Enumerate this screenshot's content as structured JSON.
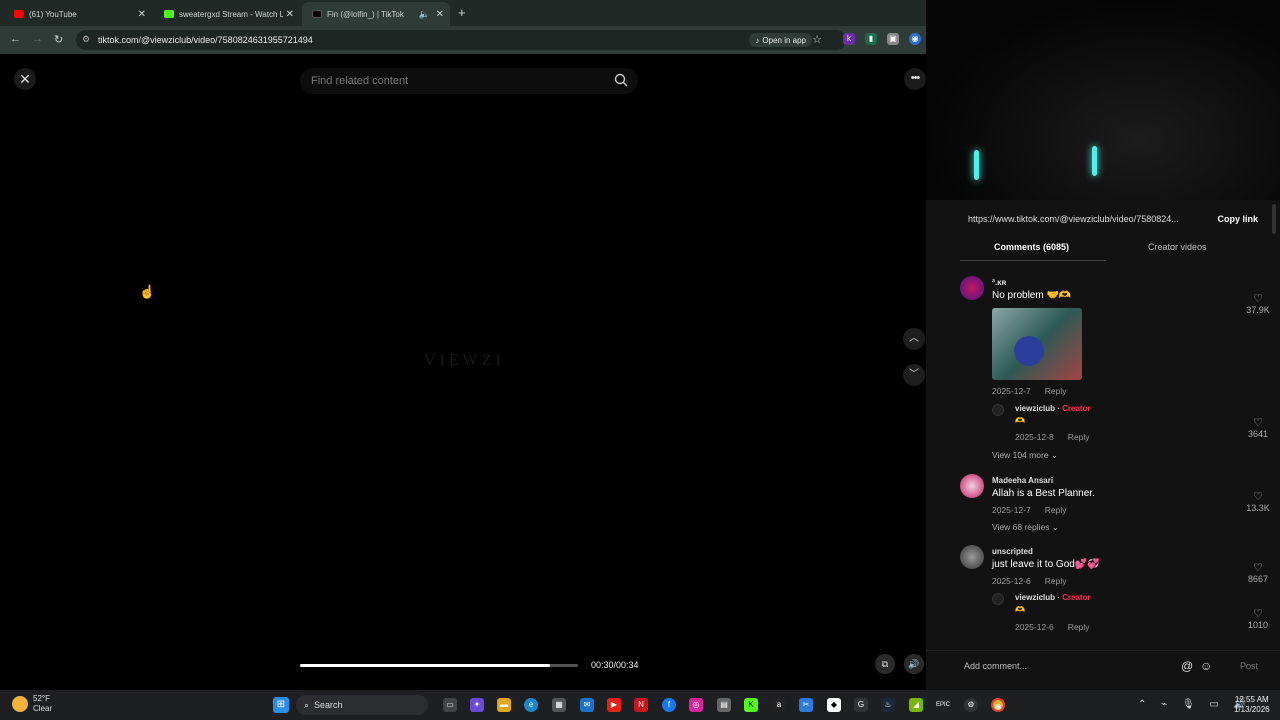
{
  "browser": {
    "tabs": [
      {
        "label": "(61) YouTube",
        "icon": "youtube-icon"
      },
      {
        "label": "sweatergxd Stream - Watch Live",
        "icon": "kick-icon"
      },
      {
        "label": "Fin (@lolfin_) | TikTok",
        "icon": "tiktok-icon",
        "active": true
      }
    ],
    "new_tab": "+",
    "url": "tiktok.com/@viewziclub/video/7580824631955721494",
    "open_in_app": "Open in app"
  },
  "video": {
    "search_placeholder": "Find related content",
    "watermark": "VIEWZI",
    "time": "00:30/00:34",
    "progress": 0.9
  },
  "panel": {
    "share_url": "https://www.tiktok.com/@viewziclub/video/7580824...",
    "copy_link": "Copy link",
    "tab_comments": "Comments (6085)",
    "tab_creator": "Creator videos",
    "comments": [
      {
        "user": "ª.ĸʀ",
        "text": "No problem 🤝🫶",
        "date": "2025-12-7",
        "reply": "Reply",
        "likes": "37.9K",
        "replies": [
          {
            "user": "viewziclub",
            "badge": "Creator",
            "text": "🫶",
            "date": "2025-12-8",
            "reply": "Reply",
            "likes": "3641"
          }
        ],
        "view_more": "View 104 more"
      },
      {
        "user": "Madeeha Ansari",
        "text": "Allah is a Best Planner.",
        "date": "2025-12-7",
        "reply": "Reply",
        "likes": "13.3K",
        "view_more": "View 68 replies"
      },
      {
        "user": "unscripted",
        "text": "just leave it to God💕💞",
        "date": "2025-12-6",
        "reply": "Reply",
        "likes": "8667",
        "replies": [
          {
            "user": "viewziclub",
            "badge": "Creator",
            "text": "🫶",
            "date": "2025-12-6",
            "reply": "Reply",
            "likes": "1010"
          }
        ]
      }
    ],
    "add_comment": "Add comment...",
    "post": "Post"
  },
  "taskbar": {
    "weather_temp": "52°F",
    "weather_desc": "Clear",
    "search": "Search",
    "time": "12:55 AM",
    "date": "1/13/2026"
  }
}
